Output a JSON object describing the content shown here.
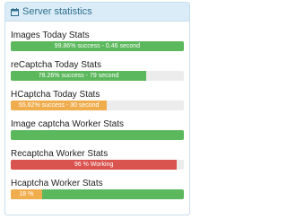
{
  "panel": {
    "title": "Server statistics",
    "icon": "calendar-icon"
  },
  "colors": {
    "success": "#5cb85c",
    "warning": "#f0ad4e",
    "danger": "#d9534f",
    "heading_bg": "#d9ecf7",
    "heading_text": "#31708f"
  },
  "stats": [
    {
      "label": "Images Today Stats",
      "bar_text": "99.86% success - 0.46 second",
      "percent": 99.86,
      "status": "success"
    },
    {
      "label": "reCaptcha Today Stats",
      "bar_text": "78.26% success - 79 second",
      "percent": 78.26,
      "status": "success"
    },
    {
      "label": "HCaptcha Today Stats",
      "bar_text": "55.62% success - 30 second",
      "percent": 55.62,
      "status": "warning"
    },
    {
      "label": "Image captcha Worker Stats",
      "bar_text": "",
      "percent": 100,
      "status": "success"
    },
    {
      "label": "Recaptcha Worker Stats",
      "bar_text": "96 % Working",
      "percent": 96,
      "status": "danger"
    },
    {
      "label": "Hcaptcha Worker Stats",
      "bar_text": "18 %",
      "percent": 18,
      "status": "warning",
      "remainder_status": "success"
    }
  ]
}
